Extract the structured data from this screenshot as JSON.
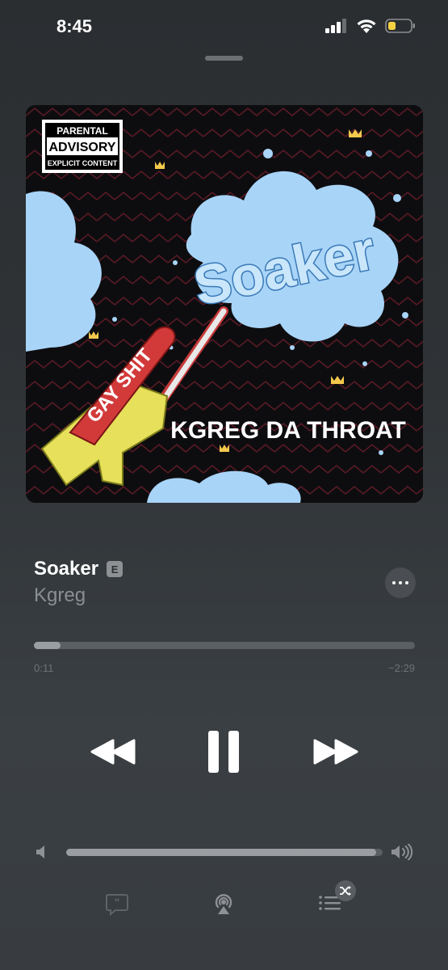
{
  "status_bar": {
    "time": "8:45",
    "icons": [
      "cellular-signal-icon",
      "wifi-icon",
      "battery-icon"
    ],
    "battery_color": "#f5d142"
  },
  "artwork": {
    "advisory_line1": "PARENTAL",
    "advisory_line2": "ADVISORY",
    "advisory_line3": "EXPLICIT CONTENT",
    "album_word": "Soaker",
    "gun_label": "GAY SHIT",
    "artist_text": "KGREG DA THROAT",
    "colors": {
      "background": "#0d0d10",
      "splash": "#a8d4f7",
      "zigzag": "#5a1a24",
      "crown": "#f2c94c"
    }
  },
  "now_playing": {
    "title": "Soaker",
    "explicit_badge": "E",
    "artist": "Kgreg",
    "more_icon": "ellipsis-icon"
  },
  "progress": {
    "elapsed": "0:11",
    "remaining": "−2:29",
    "fraction": 0.07
  },
  "controls": {
    "rewind_icon": "rewind-icon",
    "pause_icon": "pause-icon",
    "forward_icon": "fast-forward-icon"
  },
  "volume": {
    "level": 0.98,
    "low_icon": "volume-low-icon",
    "high_icon": "volume-high-icon"
  },
  "bottom_bar": {
    "icons": [
      "lyrics-icon",
      "airplay-icon",
      "queue-icon",
      "shuffle-icon"
    ]
  }
}
